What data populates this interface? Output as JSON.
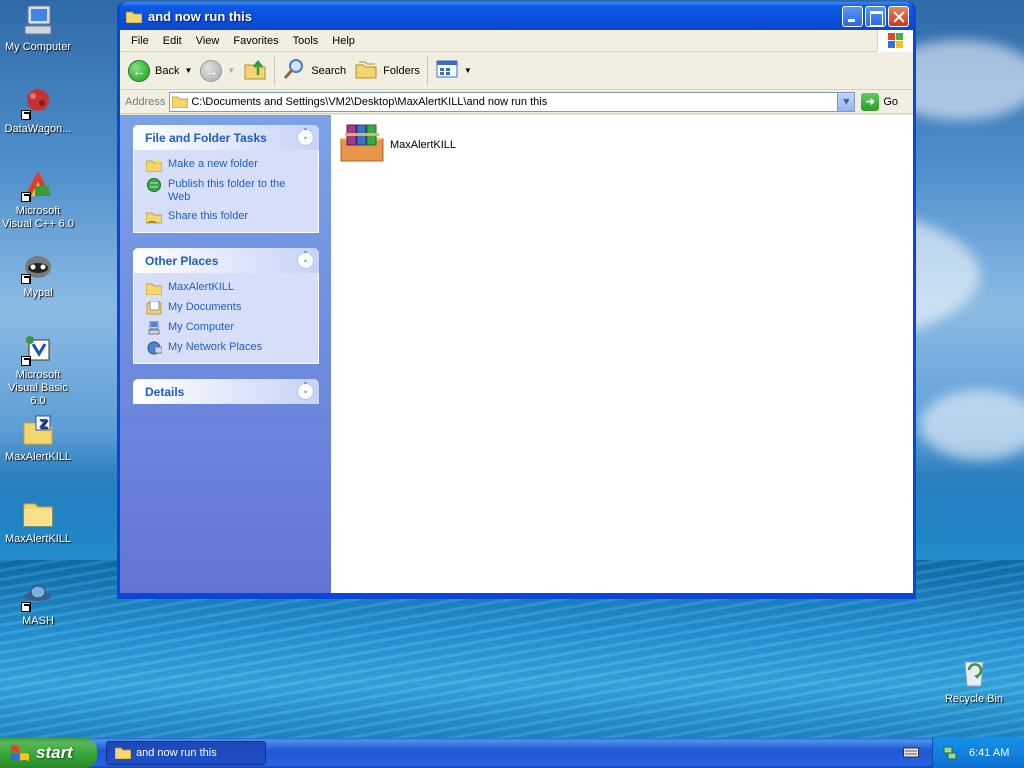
{
  "desktop": {
    "icons": [
      {
        "label": "My Computer",
        "icon": "my-computer-icon"
      },
      {
        "label": "DataWagon...",
        "icon": "datawagon-icon"
      },
      {
        "label": "Microsoft Visual C++ 6.0",
        "icon": "visual-cpp-icon"
      },
      {
        "label": "Mypal",
        "icon": "mypal-icon"
      },
      {
        "label": "Microsoft Visual Basic 6.0",
        "icon": "visual-basic-icon"
      },
      {
        "label": "MaxAlertKILL",
        "icon": "zip-folder-icon"
      },
      {
        "label": "MaxAlertKILL",
        "icon": "folder-icon"
      },
      {
        "label": "MASH",
        "icon": "mash-icon"
      },
      {
        "label": "Recycle Bin",
        "icon": "recycle-bin-icon"
      }
    ]
  },
  "window": {
    "title": "and now run this",
    "menu": [
      "File",
      "Edit",
      "View",
      "Favorites",
      "Tools",
      "Help"
    ],
    "toolbar": {
      "back_label": "Back",
      "search_label": "Search",
      "folders_label": "Folders"
    },
    "address": {
      "label": "Address",
      "value": "C:\\Documents and Settings\\VM2\\Desktop\\MaxAlertKILL\\and now run this",
      "go_label": "Go"
    },
    "taskpane": {
      "file_tasks": {
        "title": "File and Folder Tasks",
        "items": [
          "Make a new folder",
          "Publish this folder to the Web",
          "Share this folder"
        ]
      },
      "other_places": {
        "title": "Other Places",
        "items": [
          "MaxAlertKILL",
          "My Documents",
          "My Computer",
          "My Network Places"
        ]
      },
      "details": {
        "title": "Details"
      }
    },
    "files": [
      {
        "name": "MaxAlertKILL",
        "icon": "winrar-archive-icon"
      }
    ]
  },
  "taskbar": {
    "start_label": "start",
    "task_item": "and now run this",
    "clock": "6:41 AM"
  },
  "colors": {
    "titlebar": "#0a4fdc",
    "taskpane": "#7ba2e7",
    "link": "#215dc6",
    "start_green": "#35a335"
  }
}
